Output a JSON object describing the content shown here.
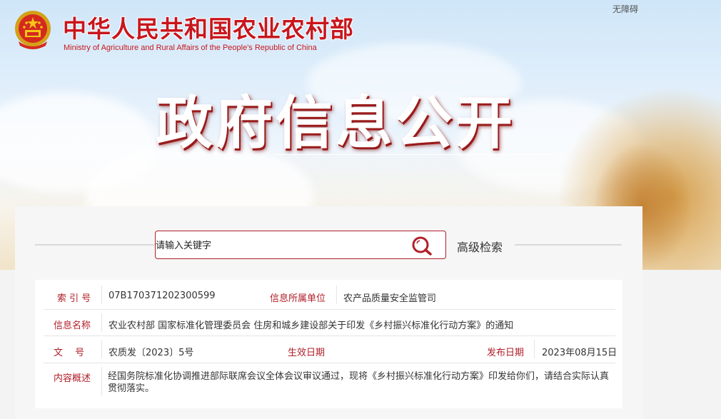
{
  "header": {
    "ministry_cn": "中华人民共和国农业农村部",
    "ministry_en": "Ministry of Agriculture and Rural Affairs of the People's Republic of China",
    "accessibility": "无障碍",
    "banner_title": "政府信息公开"
  },
  "search": {
    "placeholder": "请输入关键字",
    "advanced_label": "高级检索"
  },
  "info": {
    "index_label": "索 引 号",
    "index_value": "07B170371202300599",
    "dept_label": "信息所属单位",
    "dept_value": "农产品质量安全监管司",
    "name_label": "信息名称",
    "name_value": "农业农村部 国家标准化管理委员会 住房和城乡建设部关于印发《乡村振兴标准化行动方案》的通知",
    "doc_label": "文　 号",
    "doc_value": "农质发〔2023〕5号",
    "effective_label": "生效日期",
    "effective_value": "",
    "publish_label": "发布日期",
    "publish_value": "2023年08月15日",
    "summary_label": "内容概述",
    "summary_value": "经国务院标准化协调推进部际联席会议全体会议审议通过，现将《乡村振兴标准化行动方案》印发给你们，请结合实际认真贯彻落实。"
  },
  "colors": {
    "brand_red": "#c8161d",
    "label_red": "#b0202a"
  }
}
